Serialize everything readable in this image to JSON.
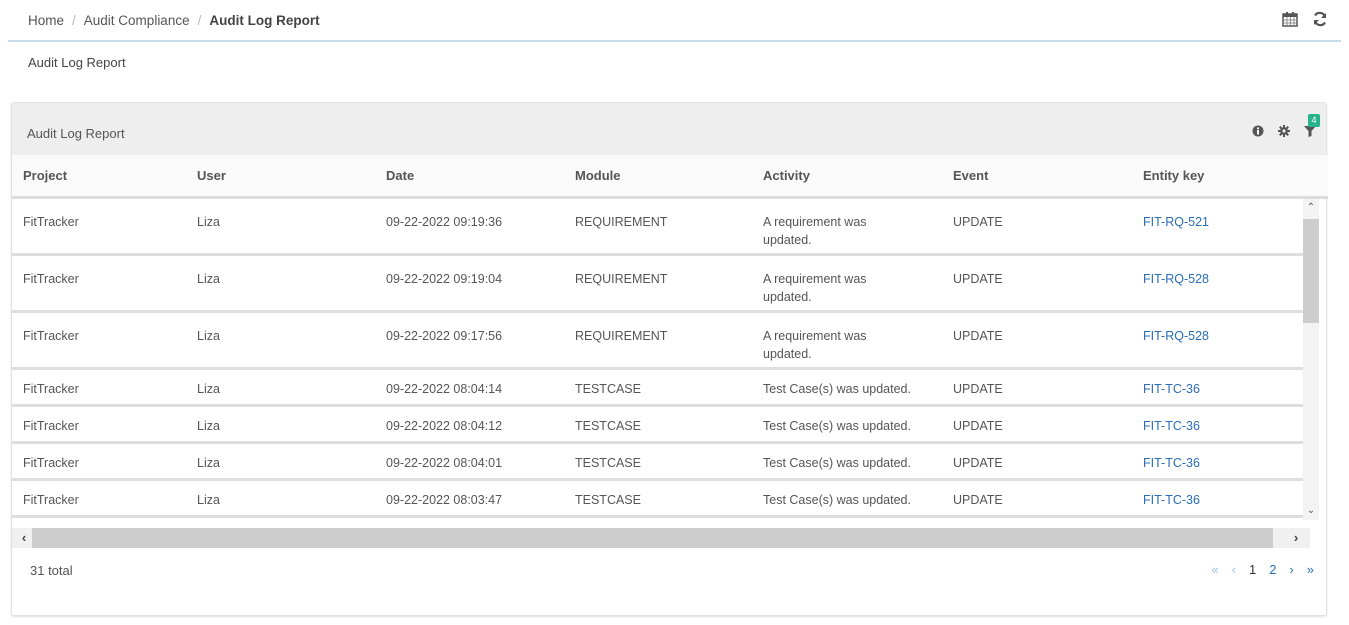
{
  "breadcrumb": {
    "items": [
      "Home",
      "Audit Compliance",
      "Audit Log Report"
    ],
    "separator": "/"
  },
  "top_icons": [
    "calendar-icon",
    "refresh-icon"
  ],
  "page_title": "Audit Log Report",
  "panel": {
    "title": "Audit Log Report",
    "filter_count": "4",
    "tools": [
      "info-icon",
      "gear-icon",
      "filter-icon"
    ]
  },
  "table": {
    "columns": [
      "Project",
      "User",
      "Date",
      "Module",
      "Activity",
      "Event",
      "Entity key"
    ],
    "rows": [
      {
        "project": "FitTracker",
        "user": "Liza",
        "date": "09-22-2022 09:19:36",
        "module": "REQUIREMENT",
        "activity": "A requirement was updated.",
        "event": "UPDATE",
        "entity_key": "FIT-RQ-521"
      },
      {
        "project": "FitTracker",
        "user": "Liza",
        "date": "09-22-2022 09:19:04",
        "module": "REQUIREMENT",
        "activity": "A requirement was updated.",
        "event": "UPDATE",
        "entity_key": "FIT-RQ-528"
      },
      {
        "project": "FitTracker",
        "user": "Liza",
        "date": "09-22-2022 09:17:56",
        "module": "REQUIREMENT",
        "activity": "A requirement was updated.",
        "event": "UPDATE",
        "entity_key": "FIT-RQ-528"
      },
      {
        "project": "FitTracker",
        "user": "Liza",
        "date": "09-22-2022 08:04:14",
        "module": "TESTCASE",
        "activity": "Test Case(s) was updated.",
        "event": "UPDATE",
        "entity_key": "FIT-TC-36"
      },
      {
        "project": "FitTracker",
        "user": "Liza",
        "date": "09-22-2022 08:04:12",
        "module": "TESTCASE",
        "activity": "Test Case(s) was updated.",
        "event": "UPDATE",
        "entity_key": "FIT-TC-36"
      },
      {
        "project": "FitTracker",
        "user": "Liza",
        "date": "09-22-2022 08:04:01",
        "module": "TESTCASE",
        "activity": "Test Case(s) was updated.",
        "event": "UPDATE",
        "entity_key": "FIT-TC-36"
      },
      {
        "project": "FitTracker",
        "user": "Liza",
        "date": "09-22-2022 08:03:47",
        "module": "TESTCASE",
        "activity": "Test Case(s) was updated.",
        "event": "UPDATE",
        "entity_key": "FIT-TC-36"
      }
    ]
  },
  "footer": {
    "total": "31 total",
    "pagination": {
      "first": "«",
      "prev": "‹",
      "pages": [
        "1",
        "2"
      ],
      "current_page": "1",
      "next": "›",
      "last": "»"
    }
  },
  "colors": {
    "link": "#2a6db5",
    "badge": "#26b48c",
    "divider": "#c5dbe8"
  }
}
